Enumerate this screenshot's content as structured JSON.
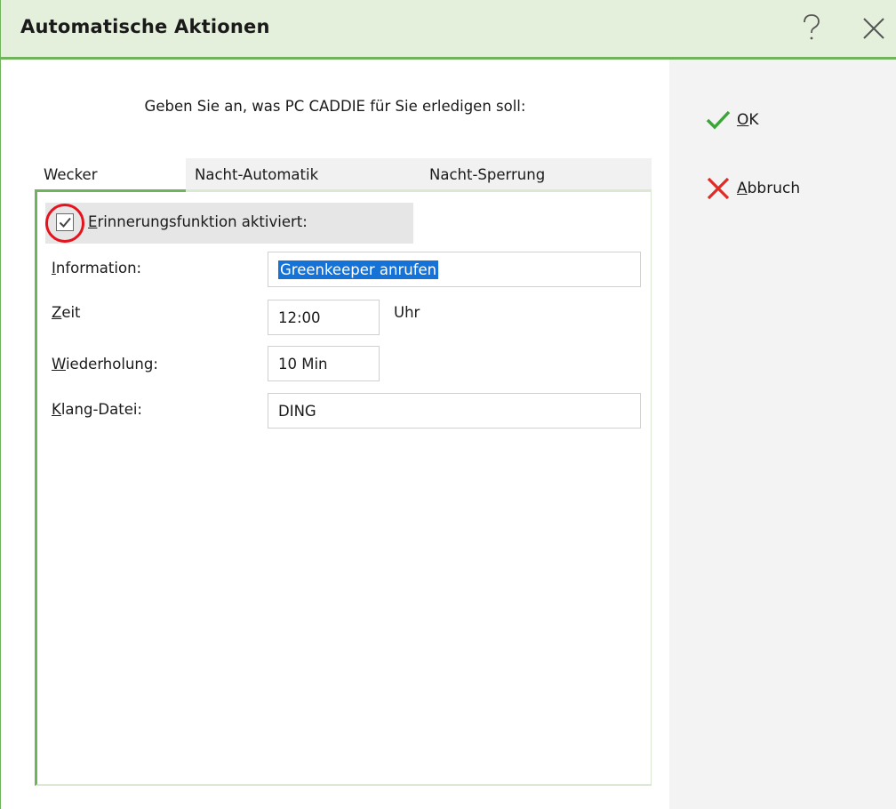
{
  "window": {
    "title": "Automatische Aktionen",
    "help_glyph": "?",
    "close_glyph": "✕"
  },
  "instruction": "Geben Sie an, was PC CADDIE für Sie erledigen soll:",
  "tabs": [
    {
      "label": "Wecker",
      "active": true
    },
    {
      "label": "Nacht-Automatik",
      "active": false
    },
    {
      "label": "Nacht-Sperrung",
      "active": false
    }
  ],
  "reminder": {
    "checkbox_label": "Erinnerungsfunktion aktiviert:",
    "checkbox_first": "E",
    "checkbox_rest": "rinnerungsfunktion aktiviert:",
    "checked": true
  },
  "fields": {
    "information": {
      "label_first": "I",
      "label_rest": "nformation:",
      "value": "Greenkeeper anrufen"
    },
    "zeit": {
      "label_first": "Z",
      "label_rest": "eit",
      "value": "12:00",
      "unit": "Uhr"
    },
    "wiederholung": {
      "label_first": "W",
      "label_rest": "iederholung:",
      "value": "10 Min"
    },
    "klang": {
      "label_first": "K",
      "label_rest": "lang-Datei:",
      "value": "DING"
    }
  },
  "buttons": {
    "ok": {
      "first": "O",
      "rest": "K",
      "icon": "check-icon"
    },
    "cancel": {
      "first": "A",
      "rest": "bbruch",
      "icon": "cross-icon"
    }
  },
  "colors": {
    "accent_green": "#6fb45a",
    "title_bg": "#e4f0dc",
    "selection_blue": "#1572d6",
    "highlight_red": "#e5131d"
  }
}
